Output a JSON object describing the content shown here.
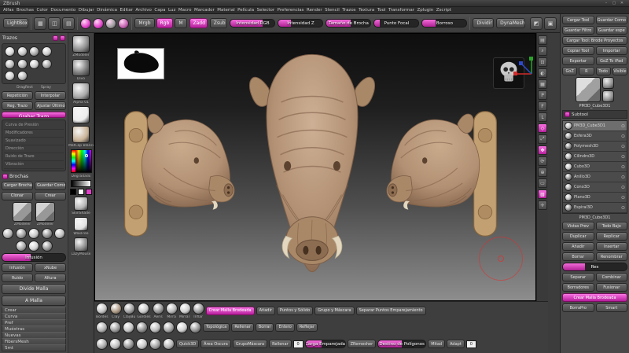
{
  "colors": {
    "accent": "#e23fca",
    "clay": "#b29073",
    "cursor_red": "#dd2d2d"
  },
  "titlebar": {
    "title": "ZBrush",
    "min": "–",
    "max": "▢",
    "close": "✕"
  },
  "menubar": {
    "items": [
      "Alfas",
      "Brochas",
      "Color",
      "Documento",
      "Dibujar",
      "Dinámica",
      "Editar",
      "Archivo",
      "Capa",
      "Luz",
      "Macro",
      "Marcador",
      "Material",
      "Película",
      "Selector",
      "Preferencias",
      "Render",
      "Stencil",
      "Trazos",
      "Textura",
      "Tool",
      "Transformar",
      "Zplugin",
      "Zscript"
    ]
  },
  "toolbar": {
    "lightbox": "LightBox",
    "left_icons": [
      {
        "g": "▦"
      },
      {
        "g": "◫"
      },
      {
        "g": "▤"
      }
    ],
    "pink_icons": [
      {
        "g": "",
        "c": "#e23fca"
      },
      {
        "g": "",
        "c": "#e23fca"
      },
      {
        "g": "",
        "c": "#9a9a9a"
      },
      {
        "g": "",
        "c": "#c45fae"
      }
    ],
    "modes": [
      {
        "label": "Mrgb"
      },
      {
        "label": "Rgb",
        "active": true
      },
      {
        "label": "M"
      }
    ],
    "zadd": {
      "label": "Zadd"
    },
    "zsub": {
      "label": "Zsub"
    },
    "sliders": [
      {
        "label": "Intensidad RGB",
        "fill": 72
      },
      {
        "label": "Intensidad Z",
        "fill": 28
      },
      {
        "label": "Tamaño de Brocha",
        "fill": 55
      },
      {
        "label": "Punto Focal",
        "fill": 12
      },
      {
        "label": "Borroso",
        "fill": 30
      }
    ],
    "divider_btn": "Dividir",
    "dynamesh_btn": "DynaMesh",
    "right_icons": [
      {
        "g": "◩"
      },
      {
        "g": "▣"
      }
    ]
  },
  "left_panel": {
    "header_title": "Trazos",
    "stroke_dots": [
      {
        "c": "#d8d8d8"
      },
      {
        "c": "#c2c2c2"
      },
      {
        "c": "#ababab"
      },
      {
        "c": "#cccccc"
      },
      {
        "c": "#bdbdbd"
      },
      {
        "c": "#b3b3b3"
      },
      {
        "c": "#c9c9c9"
      },
      {
        "c": "#a6a6a6"
      },
      {
        "c": "#d0d0d0"
      },
      {
        "c": "#bababa"
      }
    ],
    "dot_labels": [
      "DragRect",
      "Spray"
    ],
    "mini_buttons": [
      "Repetición",
      "Interpolar",
      "Reg. Trazo",
      "Ajustar Último"
    ],
    "record_bar": "Grabar Trazo",
    "modifiers": [
      "Curva de Presión",
      "Modificadores",
      "Suavizado",
      "Dirección",
      "Ruido de Trazo",
      "Vibración"
    ],
    "brush_header": "Brochas",
    "brush_buttons": [
      "Cargar Brochas",
      "Guardar Como",
      "Clonar",
      "Crear"
    ],
    "zmodeler": [
      {
        "label": "ZModeler"
      },
      {
        "label": "ZModeler"
      }
    ],
    "mini_thumbs": [
      {
        "c": "#b5b5b5"
      },
      {
        "c": "#9e9e9e"
      },
      {
        "c": "#c7c7c7"
      },
      {
        "c": "#8f8f8f"
      },
      {
        "c": "#bfbfbf"
      },
      {
        "c": "#a8a8a8"
      },
      {
        "c": "#d2d2d2"
      },
      {
        "c": "#969696"
      }
    ],
    "infusion_slider": [
      {
        "label": "Infusión",
        "fill": 45
      }
    ],
    "small_buttons": [
      "Infusión",
      "xNube",
      "Ruido",
      "Altura"
    ],
    "wide_buttons": [
      "Divide Malla",
      "A Malla"
    ],
    "bottom_list": [
      "Crear",
      "Curva",
      "Pref",
      "Muéstras",
      "Nuevas",
      "FibersMesh",
      "Smt"
    ],
    "side_thumbs": [
      {
        "label": "ZModeler",
        "c": "#8d8d8d"
      },
      {
        "label": "Divo",
        "c": "#777777"
      },
      {
        "label": "Alpha 01",
        "c": "#a8a8a8"
      },
      {
        "label": "",
        "c": "#ededed"
      },
      {
        "label": "MatCap Blanco",
        "c": "#c9b397"
      }
    ],
    "degradado_label": "Degradado",
    "below_thumbs": [
      {
        "label": "SkinShade",
        "c": "#b5b5b5"
      },
      {
        "label": "WaxFree",
        "c": "#e2e2e2"
      },
      {
        "label": "LazyMouse",
        "c": "#8a8a8a"
      }
    ]
  },
  "right_shelf": {
    "icons": [
      {
        "g": "▤"
      },
      {
        "g": "⌕"
      },
      {
        "g": "⊡"
      },
      {
        "g": "◐"
      },
      {
        "g": "▦"
      },
      {
        "g": "P"
      },
      {
        "g": "F"
      },
      {
        "g": "L"
      },
      {
        "g": "◇",
        "active": true
      },
      {
        "g": "⤢"
      },
      {
        "g": "✥",
        "active": true
      },
      {
        "g": "⟳"
      },
      {
        "g": "⊕"
      },
      {
        "g": "▭"
      },
      {
        "g": "▧",
        "active": true
      },
      {
        "g": "✛"
      }
    ]
  },
  "bottom_bar": {
    "row1_thumbs": [
      {
        "label": "Bordes",
        "c": "#c4c4c4"
      },
      {
        "label": "Clay",
        "c": "#ad9a85"
      },
      {
        "label": "ClayBu",
        "c": "#a0a0a0"
      },
      {
        "label": "Gordies",
        "c": "#c9c9c9"
      },
      {
        "label": "Aeris",
        "c": "#939393"
      },
      {
        "label": "Mirra",
        "c": "#b8b8b8"
      },
      {
        "label": "MirraT",
        "c": "#cfcfcf"
      },
      {
        "label": "Inflar",
        "c": "#9b9b9b"
      }
    ],
    "row1_buttons": [
      {
        "label": "Crear Malla Brodeada",
        "accent": true
      },
      {
        "label": "Añadir"
      },
      {
        "label": "Puntos y Sólido"
      },
      {
        "label": "Grupo y Máscara"
      },
      {
        "label": "Separar Puntos Emparejamiento"
      }
    ],
    "row2_thumbs": [
      {
        "c": "#b0b0b0"
      },
      {
        "c": "#989898"
      },
      {
        "c": "#c2c2c2"
      },
      {
        "c": "#8c8c8c"
      },
      {
        "c": "#bcbcbc"
      },
      {
        "c": "#a4a4a4"
      },
      {
        "c": "#d0d0d0"
      },
      {
        "c": "#949494"
      }
    ],
    "row2_buttons": [
      {
        "label": "Topológica"
      },
      {
        "label": "Rellenar"
      },
      {
        "label": "Borrar"
      },
      {
        "label": "Entero"
      },
      {
        "label": "Reflejar"
      }
    ],
    "row3_thumbs": [
      {
        "c": "#ababab"
      },
      {
        "c": "#bdbdbd"
      },
      {
        "c": "#939393"
      },
      {
        "c": "#c6c6c6"
      },
      {
        "c": "#9f9f9f"
      },
      {
        "c": "#b4b4b4"
      }
    ],
    "row3_buttons": [
      {
        "label": "Quick3D"
      },
      {
        "label": "Área Oscura"
      },
      {
        "label": "GrupoMáscara"
      },
      {
        "label": "Rellenar"
      }
    ],
    "input1": "0",
    "slider1": [
      {
        "label": "Carga Emparejada",
        "fill": 40
      }
    ],
    "zremesher": "ZRemesher",
    "slider2": [
      {
        "label": "Destino de Polígonos",
        "fill": 50
      }
    ],
    "row3_buttons2": [
      {
        "label": "Mitad"
      },
      {
        "label": "Adapt"
      }
    ],
    "input2": "0"
  },
  "right_panel": {
    "top_buttons": [
      "Cargar Tool",
      "Guardar Como",
      "Guardar Filtro",
      "Guardar espe"
    ],
    "wide_button": "Cargar Tool: Brode Proyectos",
    "mid_buttons": [
      "Copiar Tool",
      "Importar",
      "Exportar",
      "GoZ To iPad"
    ],
    "mini_buttons": [
      "GoZ",
      "R",
      "Todo",
      "Visible"
    ],
    "preview_label": "PM3D_Cube3D1",
    "subtool_title": "Subtool",
    "subtools": [
      {
        "name": "PM3D_Cube3D1",
        "c": "#c0c0c0",
        "sel": true
      },
      {
        "name": "Esfera3D",
        "c": "#9a9a9a"
      },
      {
        "name": "Polymesh3D",
        "c": "#888888"
      },
      {
        "name": "Cilindro3D",
        "c": "#adadad"
      },
      {
        "name": "Cubo3D",
        "c": "#c6c6c6"
      },
      {
        "name": "Anillo3D",
        "c": "#8e8e8e"
      },
      {
        "name": "Cono3D",
        "c": "#a4a4a4"
      },
      {
        "name": "Plano3D",
        "c": "#b8b8b8"
      },
      {
        "name": "Espiral3D",
        "c": "#989898"
      }
    ],
    "mid_label": "PM3D_Cube3D1",
    "action_buttons": [
      "Vistas Prev",
      "Todo Bajo",
      "Duplicar",
      "Replicar",
      "Añadir",
      "Insertar",
      "Borrar",
      "Renombrar"
    ],
    "res_slider": [
      {
        "label": "Res",
        "fill": 35
      }
    ],
    "bottom_buttons": [
      "Separar",
      "Combinar",
      "Borradores",
      "Fusionar"
    ],
    "accent_button": "Crear Malla Brodeada",
    "last_buttons": [
      "BorraPro",
      "Smart"
    ]
  }
}
